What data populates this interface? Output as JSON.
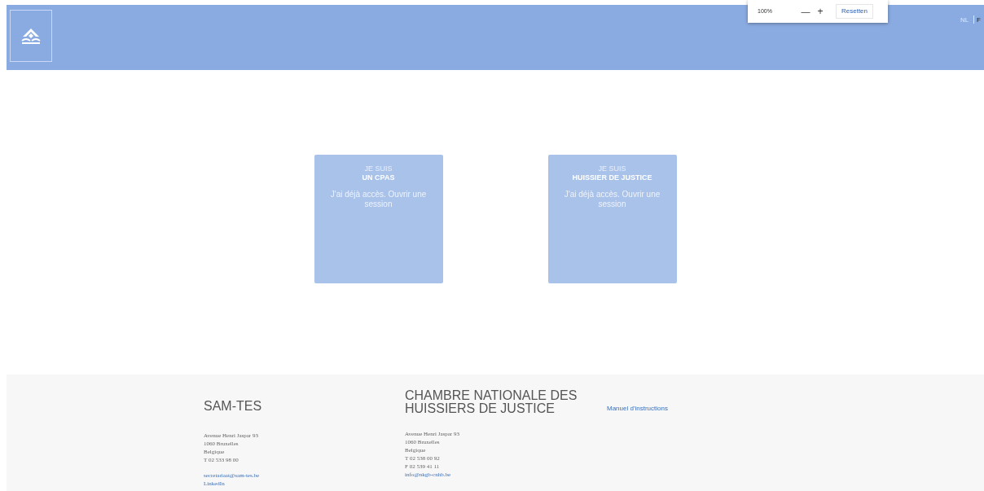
{
  "zoom_popup": {
    "level": "100%",
    "minus": "—",
    "plus": "+",
    "reset": "Resetten"
  },
  "languages": [
    {
      "label": "NL",
      "selected": false
    },
    {
      "label": "F",
      "selected": true
    }
  ],
  "cards": [
    {
      "line1": "JE SUIS",
      "line2": "UN CPAS",
      "link": "J'ai déjà accès. Ouvrir une session"
    },
    {
      "line1": "JE SUIS",
      "line2": "HUISSIER DE JUSTICE",
      "link": "J'ai déjà accès. Ouvrir une session"
    }
  ],
  "footer": {
    "columns": [
      {
        "title": "SAM-TES",
        "address": [
          "Avenue Henri Jaspar 93",
          "1060 Bruxelles",
          "Belgique",
          "T 02 533 98 00"
        ],
        "links": [
          "secretariaat@sam-tes.be",
          "LinkedIn"
        ]
      },
      {
        "title": "CHAMBRE NATIONALE DES HUISSIERS DE JUSTICE",
        "address": [
          "Avenue Henri Jaspar 93",
          "1060 Bruxelles",
          "Belgique",
          "T 02 538 00 92",
          "F 02 539 41 11"
        ],
        "links": [
          "info@nkgb-cnhb.be"
        ]
      }
    ],
    "manual_link": "Manuel d'instructions"
  }
}
